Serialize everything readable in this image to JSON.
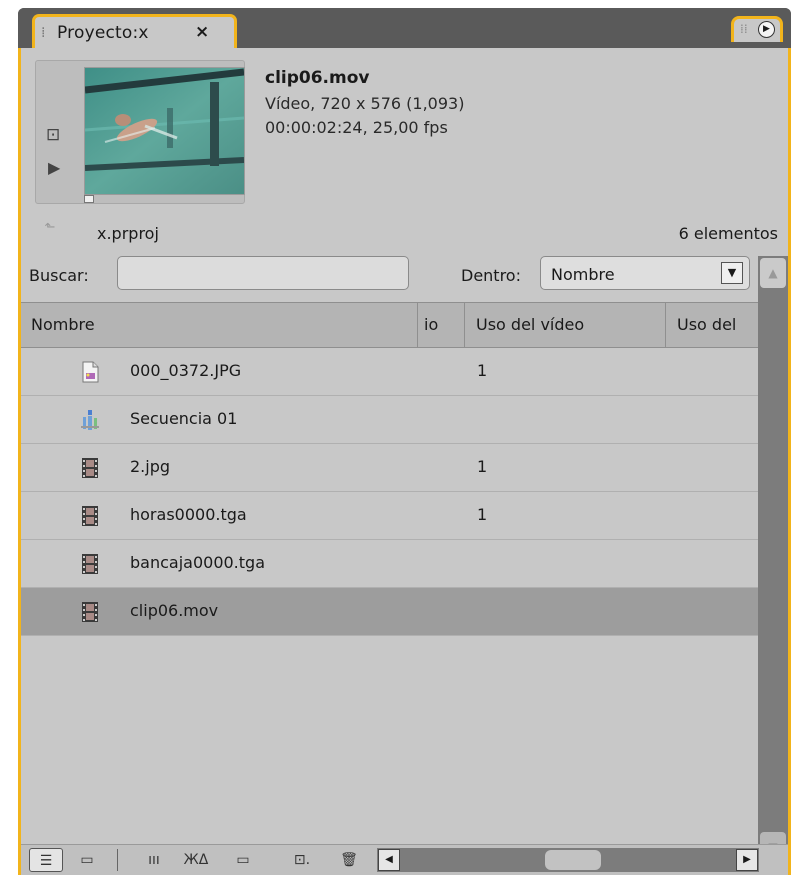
{
  "panel": {
    "tab_label": "Proyecto:x",
    "tab_close": "×",
    "menu_button": "▶"
  },
  "preview": {
    "clip_name": "clip06.mov",
    "line1": "Vídeo, 720 x 576 (1,093)",
    "line2": "00:00:02:24, 25,00 fps",
    "poster_frame_icon": "camera-icon",
    "play_icon": "play-icon"
  },
  "project": {
    "name": "x.prproj",
    "item_count": "6 elementos"
  },
  "search": {
    "label": "Buscar:",
    "value": "",
    "placeholder": "",
    "within_label": "Dentro:",
    "within_value": "Nombre",
    "within_arrow": "▼"
  },
  "columns": {
    "name": "Nombre",
    "partial": "io",
    "video_usage": "Uso del vídeo",
    "audio_usage_partial": "Uso del"
  },
  "items": [
    {
      "name": "000_0372.JPG",
      "video_usage": "1",
      "icon": "image-file-icon",
      "selected": false
    },
    {
      "name": "Secuencia 01",
      "video_usage": "",
      "icon": "sequence-icon",
      "selected": false
    },
    {
      "name": "2.jpg",
      "video_usage": "1",
      "icon": "film-strip-icon",
      "selected": false
    },
    {
      "name": "horas0000.tga",
      "video_usage": "1",
      "icon": "film-strip-icon",
      "selected": false
    },
    {
      "name": "bancaja0000.tga",
      "video_usage": "",
      "icon": "film-strip-icon",
      "selected": false
    },
    {
      "name": "clip06.mov",
      "video_usage": "",
      "icon": "film-strip-icon",
      "selected": true
    }
  ],
  "toolbar": {
    "list_view": "☰",
    "icon_view": "▭",
    "automate": "ııı",
    "find": "ЖΔ",
    "new_bin": "▭",
    "new_item": "⊡.",
    "delete": "🗑"
  },
  "colors": {
    "panel_bg": "#c8c8c8",
    "focus_border": "#f2b41b",
    "selected_row": "#9d9d9d",
    "chrome_dark": "#5a5a5a"
  }
}
